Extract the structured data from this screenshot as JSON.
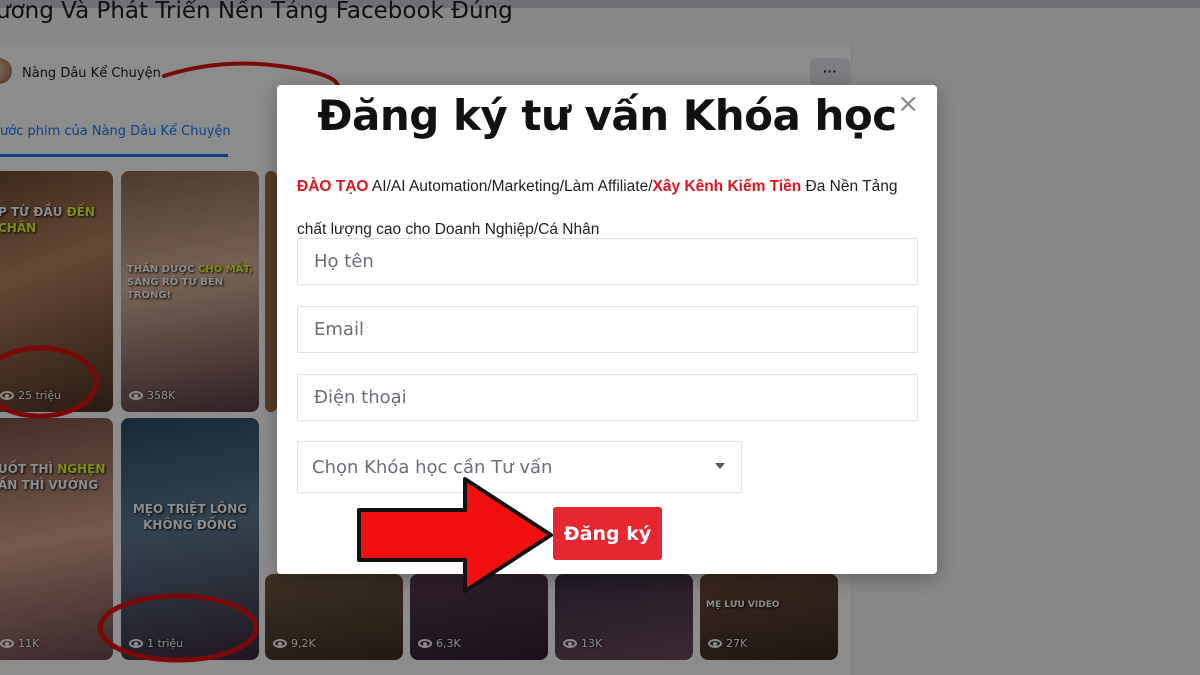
{
  "background": {
    "page_title": "ương Và Phát Triển Nền Tảng Facebook Đúng",
    "page_name": "Nàng Dâu Kể Chuyện",
    "more_label": "···",
    "active_tab": "ước phim của Nàng Dâu Kể Chuyện",
    "thumbnails": [
      {
        "caption_pre": "P TỪ ĐẦU ",
        "caption_hl": "ĐẾN CHÂN",
        "views": "25 triệu"
      },
      {
        "caption_pre": "THẦN DƯỢC ",
        "caption_hl": "CHO MẮT,",
        "caption_post": " SÁNG RÕ TỪ BÊN TRONG!",
        "views": "358K"
      },
      {
        "caption_pre": "UỐT THÌ ",
        "caption_hl": "NGHẸN",
        "caption_post": " ẤN THÌ VƯỚNG",
        "views": "11K"
      },
      {
        "caption_pre": "MẸO TRIỆT LÔNG KHÔNG ĐỐNG",
        "caption_hl": "",
        "views": "1 triệu"
      },
      {
        "caption_pre": "",
        "caption_hl": "",
        "views": "9,2K"
      },
      {
        "caption_pre": "",
        "caption_hl": "",
        "views": "6,3K"
      },
      {
        "caption_pre": "",
        "caption_hl": "",
        "views": "13K"
      },
      {
        "caption_pre": "MẸ LƯU VIDEO",
        "caption_hl": "",
        "views": "27K"
      }
    ]
  },
  "modal": {
    "title": "Đăng ký tư vấn Khóa học",
    "close_label": "×",
    "desc_red1": "ĐÀO TẠO",
    "desc_mid": " AI/AI Automation/Marketing/Làm Affiliate/",
    "desc_red2": "Xây Kênh Kiếm Tiền",
    "desc_end": " Đa Nền Tảng chất lượng cao cho Doanh Nghiệp/Cá Nhân",
    "name_placeholder": "Họ tên",
    "email_placeholder": "Email",
    "phone_placeholder": "Điện thoại",
    "course_select": "Chọn Khóa học cần Tư vấn",
    "submit_label": "Đăng ký"
  },
  "colors": {
    "accent_red": "#e8262f",
    "fb_blue": "#1877f2",
    "annotation_red": "#e0141e"
  },
  "icons": [
    "close-icon",
    "eye-icon",
    "chevron-down-icon",
    "more-icon",
    "red-arrow-icon"
  ]
}
